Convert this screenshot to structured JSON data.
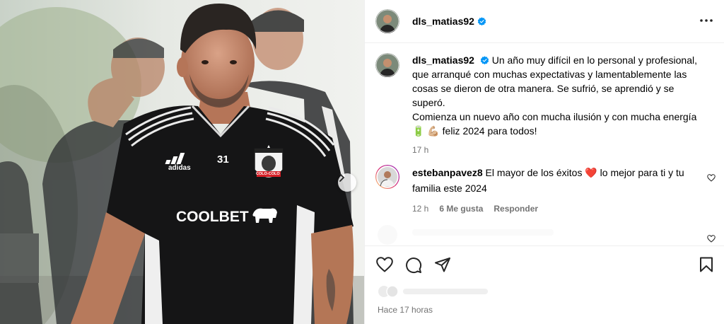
{
  "post": {
    "username": "dls_matias92",
    "verified": true,
    "jersey_number": "31",
    "jersey_brand": "adidas",
    "sponsor": "COOLBET",
    "badge_text": "COLO-COLO"
  },
  "caption": {
    "username": "dls_matias92",
    "text_1": "Un año muy difícil en lo personal y profesional, que arranqué con muchas expectativas y lamentablemente las cosas se dieron de otra manera. Se sufrió, se aprendió y se superó.",
    "text_2": "Comienza un nuevo año con mucha ilusión y con mucha energía",
    "emoji_1": "🔋",
    "emoji_2": "💪🏼",
    "text_3": "feliz 2024 para todos!",
    "time": "17 h"
  },
  "comment": {
    "username": "estebanpavez8",
    "text_1": "El mayor de los éxitos",
    "emoji": "❤️",
    "text_2": "lo mejor para ti y tu familia este 2024",
    "time": "12 h",
    "likes": "6 Me gusta",
    "reply": "Responder"
  },
  "footer": {
    "timestamp": "Hace 17 horas"
  },
  "icons": {
    "verified": "verified-badge-icon",
    "more": "more-options-icon",
    "like": "heart-icon",
    "comment": "comment-icon",
    "share": "share-icon",
    "save": "bookmark-icon",
    "next": "chevron-right-icon"
  },
  "colors": {
    "verified_blue": "#0095f6",
    "heart_red": "#ed4956",
    "meta_gray": "#737373",
    "divider": "#efefef"
  }
}
